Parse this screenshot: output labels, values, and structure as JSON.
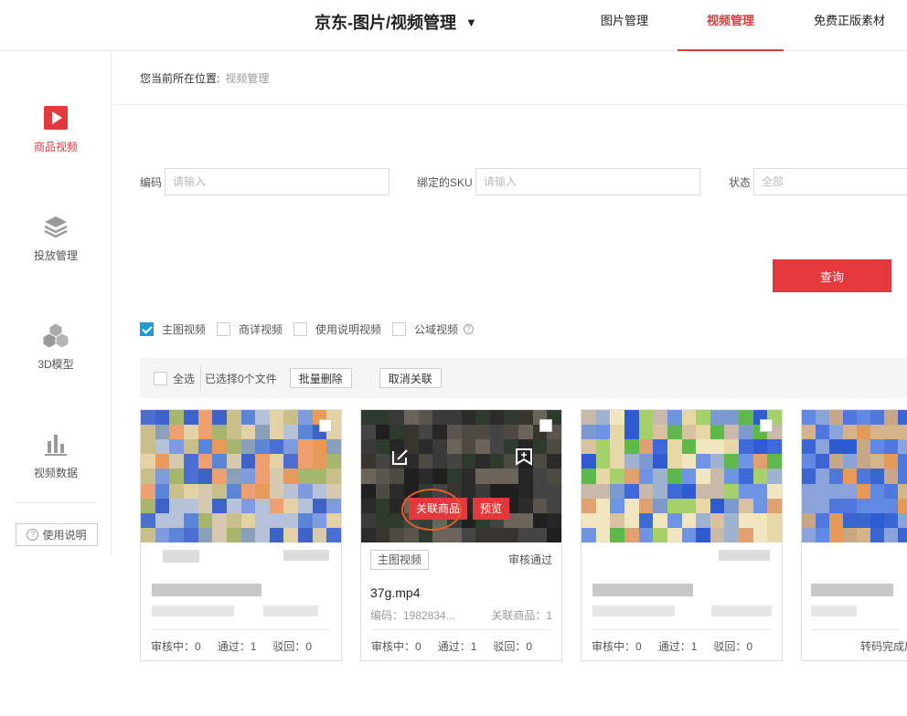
{
  "header": {
    "brand": "京东-图片/视频管理",
    "brand_caret": "▼",
    "tabs": [
      "图片管理",
      "视频管理",
      "免费正版素材"
    ],
    "active_tab": "视频管理",
    "accent": "#e4393c"
  },
  "sidebar": {
    "items": [
      {
        "label": "商品视频",
        "icon": "video-camera-icon",
        "active": true
      },
      {
        "label": "投放管理",
        "icon": "layers-icon"
      },
      {
        "label": "3D模型",
        "icon": "cubes-icon"
      },
      {
        "label": "视频数据",
        "icon": "bar-chart-icon"
      }
    ],
    "help_label": "使用说明"
  },
  "breadcrumb": {
    "prefix": "您当前所在位置:",
    "current": "视频管理"
  },
  "filters": {
    "code_label": "编码",
    "code_placeholder": "请输入",
    "sku_label": "绑定的SKU",
    "sku_placeholder": "请输入",
    "status_label": "状态",
    "status_value": "全部",
    "query_label": "查询"
  },
  "video_types": [
    {
      "label": "主图视频",
      "checked": true
    },
    {
      "label": "商详视频",
      "checked": false
    },
    {
      "label": "使用说明视频",
      "checked": false
    },
    {
      "label": "公域视频",
      "checked": false
    }
  ],
  "info_icon": "?",
  "toolbar": {
    "select_all": "全选",
    "selected_count": "已选择0个文件",
    "bulk_delete": "批量删除",
    "unlink": "取消关联"
  },
  "cards": [
    {
      "stats": [
        "审核中：0",
        "通过：1",
        "驳回：0"
      ]
    },
    {
      "badge": "主图视频",
      "status": "审核通过",
      "filename": "37g.mp4",
      "code": "编码：1982834...",
      "linked": "关联商品：1",
      "link_btn": "关联商品",
      "preview_btn": "预览",
      "stats": [
        "审核中：0",
        "通过：1",
        "驳回：0"
      ]
    },
    {
      "stats": [
        "审核中：0",
        "通过：1",
        "驳回：0"
      ]
    },
    {
      "convert_status": "转码完成后"
    }
  ]
}
